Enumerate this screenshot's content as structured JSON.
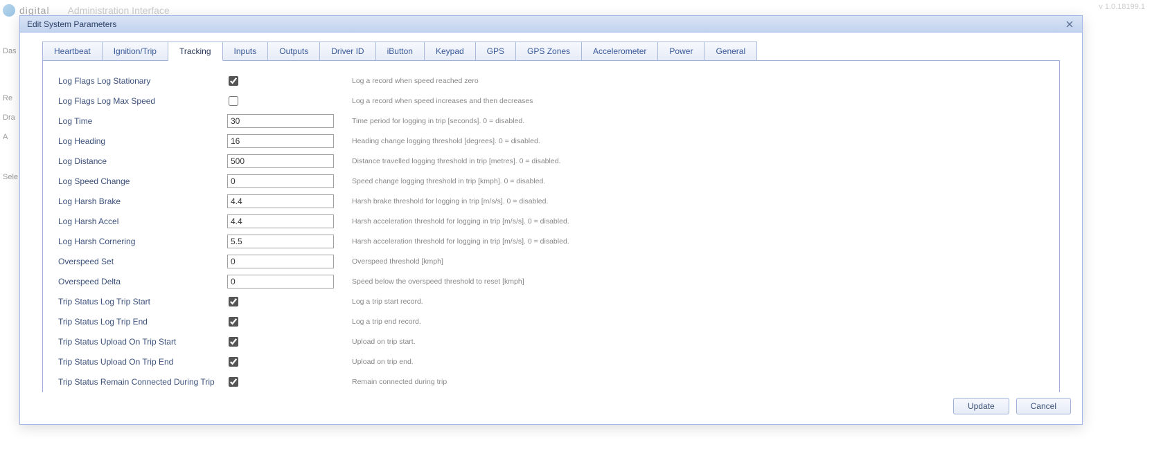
{
  "background": {
    "brand": "digital",
    "subtitle": "Administration Interface",
    "version": "v 1.0.18199.1",
    "sidebar": [
      "Das",
      "Re",
      "Dra",
      "A",
      "Sele"
    ]
  },
  "modal": {
    "title": "Edit System Parameters",
    "tabs": [
      {
        "label": "Heartbeat"
      },
      {
        "label": "Ignition/Trip"
      },
      {
        "label": "Tracking",
        "active": true
      },
      {
        "label": "Inputs"
      },
      {
        "label": "Outputs"
      },
      {
        "label": "Driver ID"
      },
      {
        "label": "iButton"
      },
      {
        "label": "Keypad"
      },
      {
        "label": "GPS"
      },
      {
        "label": "GPS Zones"
      },
      {
        "label": "Accelerometer"
      },
      {
        "label": "Power"
      },
      {
        "label": "General"
      }
    ],
    "rows": [
      {
        "label": "Log Flags Log Stationary",
        "type": "checkbox",
        "checked": true,
        "hint": "Log a record when speed reached zero"
      },
      {
        "label": "Log Flags Log Max Speed",
        "type": "checkbox",
        "checked": false,
        "hint": "Log a record when speed increases and then decreases"
      },
      {
        "label": "Log Time",
        "type": "text",
        "value": "30",
        "hint": "Time period for logging in trip [seconds]. 0 = disabled."
      },
      {
        "label": "Log Heading",
        "type": "text",
        "value": "16",
        "hint": "Heading change logging threshold [degrees]. 0 = disabled."
      },
      {
        "label": "Log Distance",
        "type": "text",
        "value": "500",
        "hint": "Distance travelled logging threshold in trip [metres]. 0 = disabled."
      },
      {
        "label": "Log Speed Change",
        "type": "text",
        "value": "0",
        "hint": "Speed change logging threshold in trip [kmph]. 0 = disabled."
      },
      {
        "label": "Log Harsh Brake",
        "type": "text",
        "value": "4.4",
        "hint": "Harsh brake threshold for logging in trip [m/s/s]. 0 = disabled."
      },
      {
        "label": "Log Harsh Accel",
        "type": "text",
        "value": "4.4",
        "hint": "Harsh acceleration threshold for logging in trip [m/s/s]. 0 = disabled."
      },
      {
        "label": "Log Harsh Cornering",
        "type": "text",
        "value": "5.5",
        "hint": "Harsh acceleration threshold for logging in trip [m/s/s]. 0 = disabled."
      },
      {
        "label": "Overspeed Set",
        "type": "text",
        "value": "0",
        "hint": "Overspeed threshold [kmph]"
      },
      {
        "label": "Overspeed Delta",
        "type": "text",
        "value": "0",
        "hint": "Speed below the overspeed threshold to reset [kmph]"
      },
      {
        "label": "Trip Status Log Trip Start",
        "type": "checkbox",
        "checked": true,
        "hint": "Log a trip start record."
      },
      {
        "label": "Trip Status Log Trip End",
        "type": "checkbox",
        "checked": true,
        "hint": "Log a trip end record."
      },
      {
        "label": "Trip Status Upload On Trip Start",
        "type": "checkbox",
        "checked": true,
        "hint": "Upload on trip start."
      },
      {
        "label": "Trip Status Upload On Trip End",
        "type": "checkbox",
        "checked": true,
        "hint": "Upload on trip end."
      },
      {
        "label": "Trip Status Remain Connected During Trip",
        "type": "checkbox",
        "checked": true,
        "hint": "Remain connected during trip"
      }
    ],
    "buttons": {
      "update": "Update",
      "cancel": "Cancel"
    }
  }
}
